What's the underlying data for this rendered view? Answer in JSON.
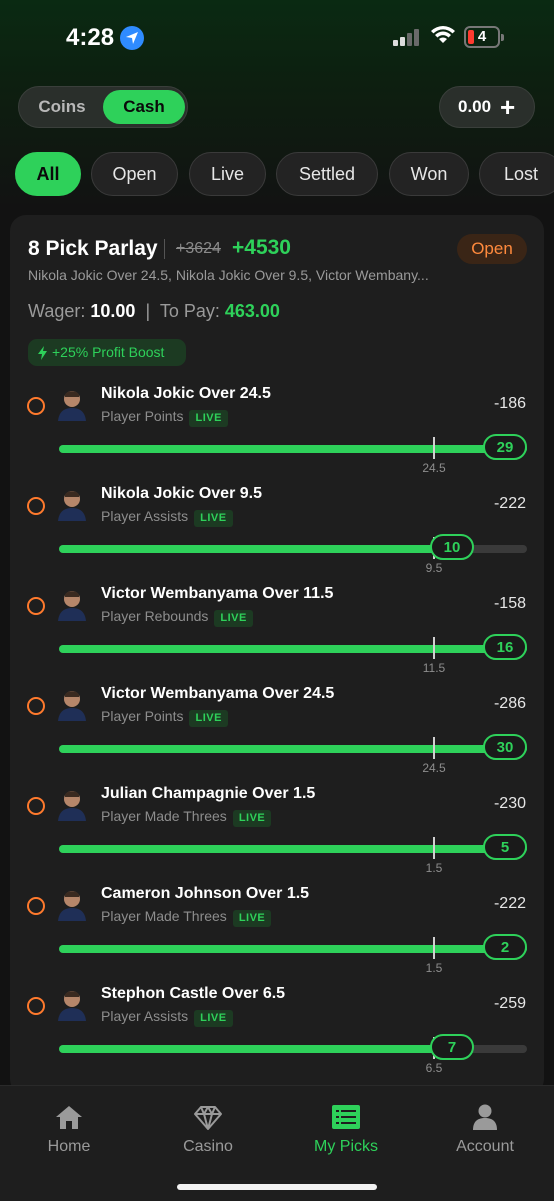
{
  "status_bar": {
    "time": "4:28",
    "battery": "4"
  },
  "wallet": {
    "coins_label": "Coins",
    "cash_label": "Cash",
    "balance": "0.00"
  },
  "filters": [
    "All",
    "Open",
    "Live",
    "Settled",
    "Won",
    "Lost"
  ],
  "parlay": {
    "title": "8 Pick Parlay",
    "old_odds": "+3624",
    "new_odds": "+4530",
    "status": "Open",
    "description": "Nikola Jokic Over 24.5, Nikola Jokic Over 9.5, Victor Wembany...",
    "wager_label": "Wager:",
    "wager": "10.00",
    "to_pay_label": "To Pay:",
    "to_pay": "463.00",
    "boost": "+25% Profit Boost"
  },
  "legs": [
    {
      "name": "Nikola Jokic Over 24.5",
      "market": "Player Points",
      "live": "LIVE",
      "odds": "-186",
      "current": "29",
      "line": "24.5",
      "progress": 1.0,
      "line_pos": 0.8
    },
    {
      "name": "Nikola Jokic Over 9.5",
      "market": "Player Assists",
      "live": "LIVE",
      "odds": "-222",
      "current": "10",
      "line": "9.5",
      "progress": 0.84,
      "line_pos": 0.8
    },
    {
      "name": "Victor Wembanyama Over 11.5",
      "market": "Player Rebounds",
      "live": "LIVE",
      "odds": "-158",
      "current": "16",
      "line": "11.5",
      "progress": 1.0,
      "line_pos": 0.8
    },
    {
      "name": "Victor Wembanyama Over 24.5",
      "market": "Player Points",
      "live": "LIVE",
      "odds": "-286",
      "current": "30",
      "line": "24.5",
      "progress": 1.0,
      "line_pos": 0.8
    },
    {
      "name": "Julian Champagnie Over 1.5",
      "market": "Player Made Threes",
      "live": "LIVE",
      "odds": "-230",
      "current": "5",
      "line": "1.5",
      "progress": 1.0,
      "line_pos": 0.8
    },
    {
      "name": "Cameron Johnson Over 1.5",
      "market": "Player Made Threes",
      "live": "LIVE",
      "odds": "-222",
      "current": "2",
      "line": "1.5",
      "progress": 1.0,
      "line_pos": 0.8
    },
    {
      "name": "Stephon Castle Over 6.5",
      "market": "Player Assists",
      "live": "LIVE",
      "odds": "-259",
      "current": "7",
      "line": "6.5",
      "progress": 0.84,
      "line_pos": 0.8
    }
  ],
  "nav": [
    {
      "label": "Home",
      "icon": "home-icon"
    },
    {
      "label": "Casino",
      "icon": "diamond-icon"
    },
    {
      "label": "My Picks",
      "icon": "picks-icon"
    },
    {
      "label": "Account",
      "icon": "account-icon"
    }
  ],
  "colors": {
    "accent": "#2ed15a",
    "open": "#ff8a3d"
  }
}
